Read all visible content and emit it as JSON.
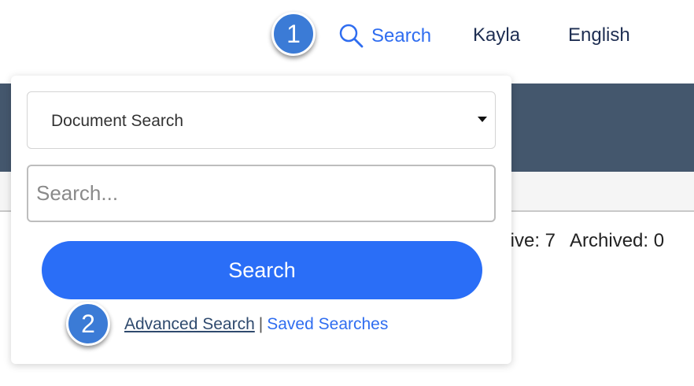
{
  "nav": {
    "search_label": "Search",
    "search_icon": "search-icon",
    "user_name": "Kayla",
    "language": "English"
  },
  "callouts": {
    "first": "1",
    "second": "2"
  },
  "page": {
    "active_count": "ctive: 7",
    "archived_count": "Archived: 0"
  },
  "search_panel": {
    "type_select_value": "Document Search",
    "query_placeholder": "Search...",
    "submit_label": "Search",
    "advanced_search_link": "Advanced Search",
    "separator": "|",
    "saved_searches_link": "Saved Searches"
  },
  "colors": {
    "accent": "#2a6ef7",
    "link": "#2f6df0",
    "banner": "#44576d",
    "callout": "#3b7bd6",
    "nav_text": "#1e2e52"
  }
}
